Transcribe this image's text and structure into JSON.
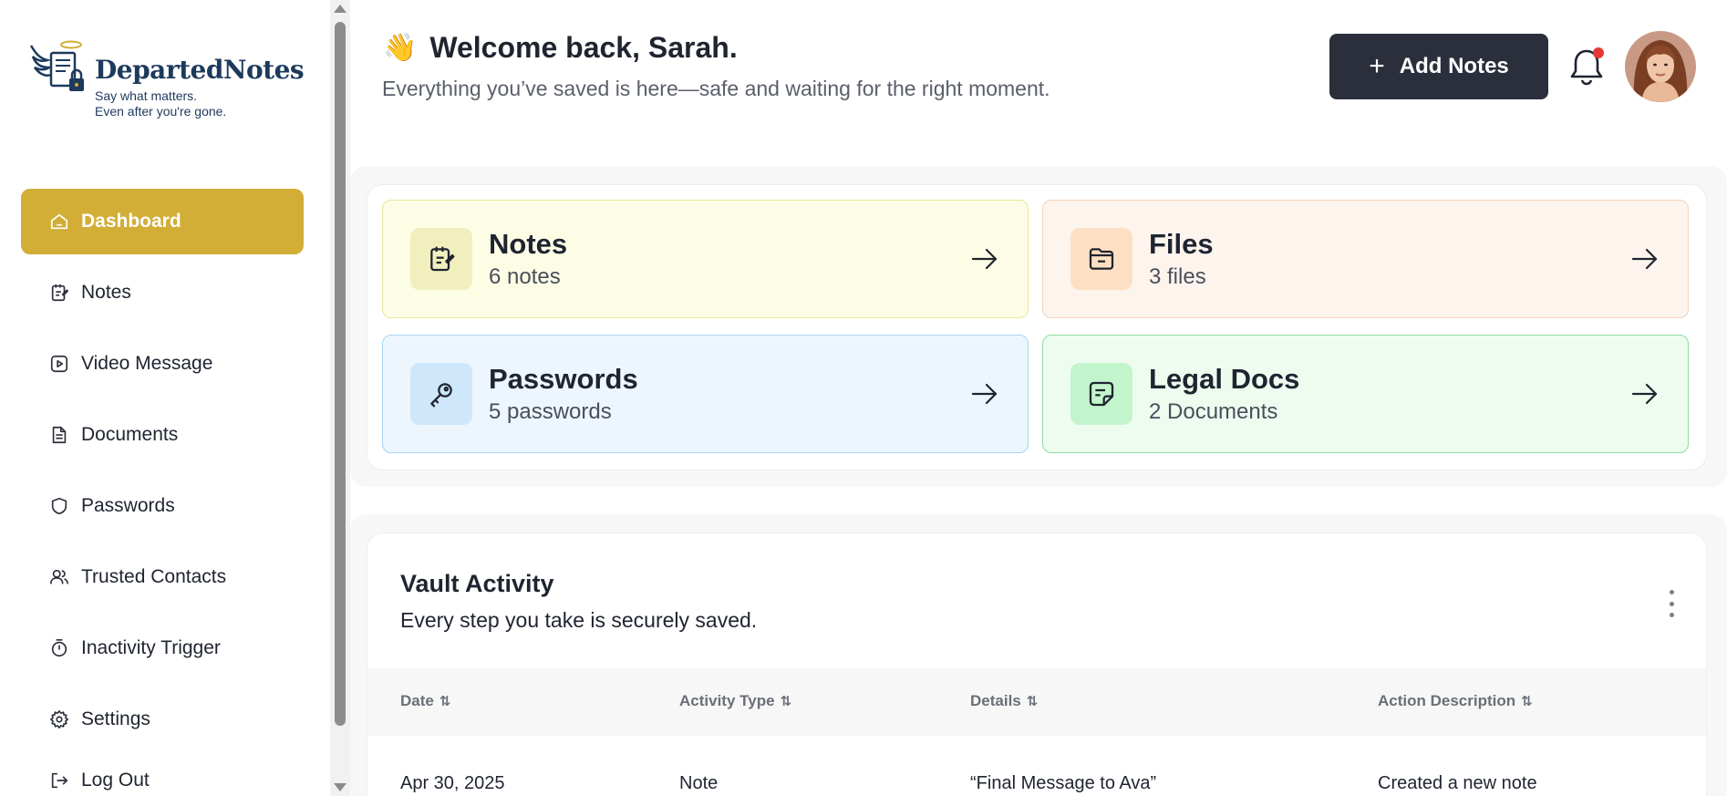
{
  "brand": {
    "name": "DepartedNotes",
    "tagline_line1": "Say what matters.",
    "tagline_line2": "Even after you're gone."
  },
  "sidebar": {
    "items": [
      {
        "label": "Dashboard",
        "icon": "home-icon",
        "active": true
      },
      {
        "label": "Notes",
        "icon": "notepad-icon"
      },
      {
        "label": "Video Message",
        "icon": "video-icon"
      },
      {
        "label": "Documents",
        "icon": "document-icon"
      },
      {
        "label": "Passwords",
        "icon": "shield-icon"
      },
      {
        "label": "Trusted Contacts",
        "icon": "users-icon"
      },
      {
        "label": "Inactivity Trigger",
        "icon": "stopwatch-icon"
      },
      {
        "label": "Settings",
        "icon": "gear-icon"
      },
      {
        "label": "Log Out",
        "icon": "logout-icon"
      }
    ]
  },
  "header": {
    "wave": "👋",
    "welcome": "Welcome back, Sarah.",
    "subtitle": "Everything you’ve saved is here—safe and waiting for the right moment.",
    "add_button": "Add Notes",
    "notifications_unread": true
  },
  "cards": {
    "notes": {
      "title": "Notes",
      "count": "6 notes",
      "icon": "notepad-icon"
    },
    "files": {
      "title": "Files",
      "count": "3 files",
      "icon": "folder-icon"
    },
    "passwords": {
      "title": "Passwords",
      "count": "5 passwords",
      "icon": "key-icon"
    },
    "legal": {
      "title": "Legal Docs",
      "count": "2 Documents",
      "icon": "sticky-note-icon"
    }
  },
  "activity": {
    "title": "Vault Activity",
    "subtitle": "Every step you take is securely saved.",
    "columns": [
      "Date",
      "Activity Type",
      "Details",
      "Action Description"
    ],
    "sort_glyph": "⇅",
    "rows": [
      {
        "date": "Apr 30, 2025",
        "type": "Note",
        "details": "“Final Message to Ava”",
        "action": "Created a new note"
      }
    ]
  },
  "colors": {
    "accent": "#d2ae37",
    "dark_button": "#2b2f3b",
    "brand_navy": "#1d3a5c",
    "notification_dot": "#e53935"
  }
}
